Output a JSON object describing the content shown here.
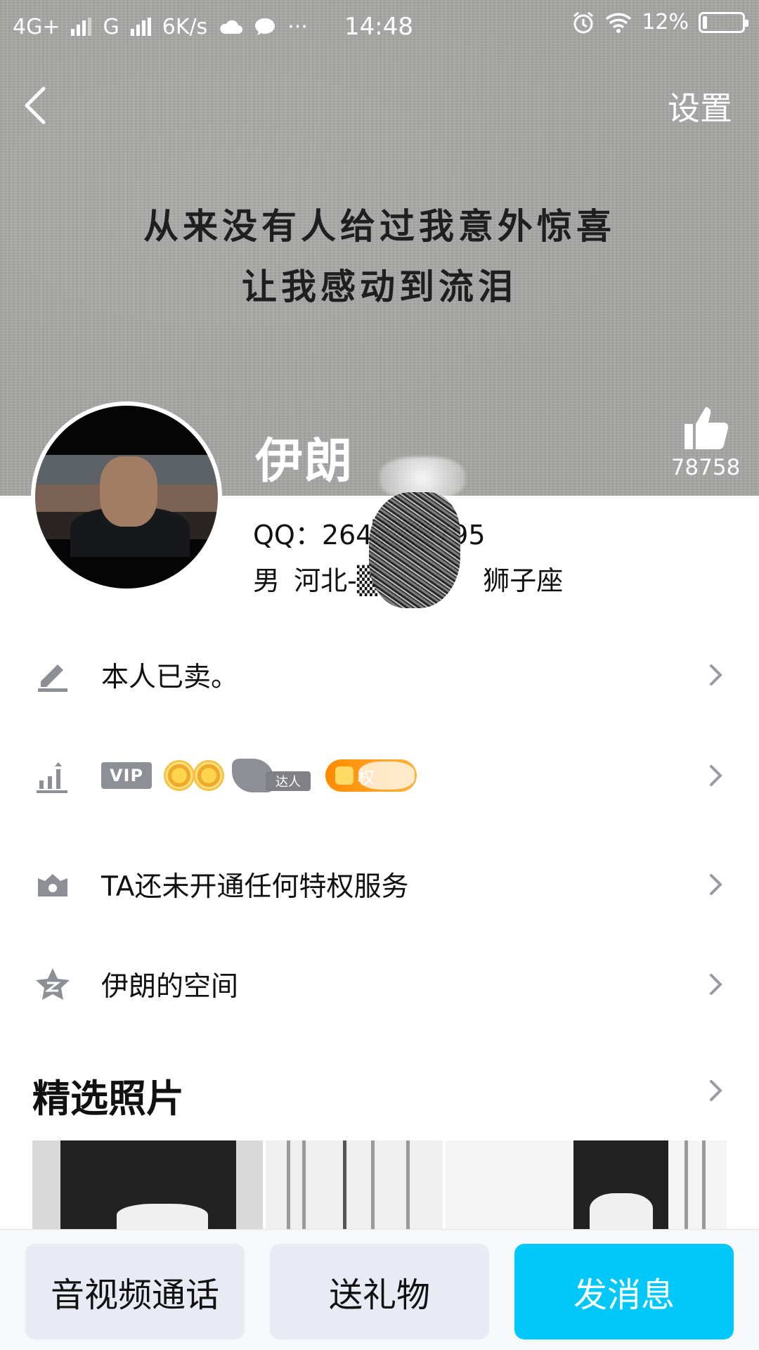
{
  "status_bar": {
    "network1": "4G+",
    "network2": "G",
    "speed": "6K/s",
    "more": "···",
    "time": "14:48",
    "battery": "12%",
    "battery_level": 0.12
  },
  "header": {
    "settings_label": "设置",
    "cover_line1": "从来没有人给过我意外惊喜",
    "cover_line2": "让我感动到流泪",
    "like_count": "78758"
  },
  "profile": {
    "name": "伊朗",
    "qq": "QQ：264▒▒▒795",
    "gender": "男",
    "location": "河北-▒",
    "zodiac": "狮子座"
  },
  "rows": {
    "signature": "本人已卖。",
    "vip_badge": "VIP",
    "daren_badge": "达人",
    "orange_badge": "权",
    "privilege": "TA还未开通任何特权服务",
    "space": "伊朗的空间"
  },
  "photos": {
    "title": "精选照片"
  },
  "bottom": {
    "call": "音视频通话",
    "gift": "送礼物",
    "message": "发消息"
  },
  "colors": {
    "accent": "#00c8fb",
    "icon_gray": "#8d8f96",
    "button_bg": "#e9ebf4"
  }
}
